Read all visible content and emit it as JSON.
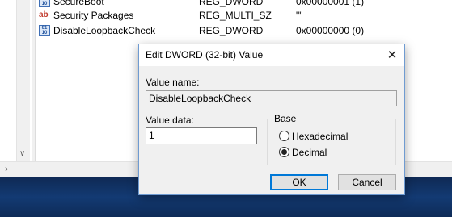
{
  "registry": {
    "rows": [
      {
        "name": "SecureBoot",
        "type": "REG_DWORD",
        "data": "0x00000001 (1)",
        "icon": "dword-icon"
      },
      {
        "name": "Security Packages",
        "type": "REG_MULTI_SZ",
        "data": "\"\"",
        "icon": "string-ab-icon"
      },
      {
        "name": "DisableLoopbackCheck",
        "type": "REG_DWORD",
        "data": "0x00000000 (0)",
        "icon": "dword-icon"
      }
    ]
  },
  "dialog": {
    "title": "Edit DWORD (32-bit) Value",
    "value_name_label": "Value name:",
    "value_name": "DisableLoopbackCheck",
    "value_data_label": "Value data:",
    "value_data": "1",
    "base_label": "Base",
    "base_options": [
      {
        "label": "Hexadecimal",
        "selected": false
      },
      {
        "label": "Decimal",
        "selected": true
      }
    ],
    "ok_label": "OK",
    "cancel_label": "Cancel"
  },
  "colors": {
    "taskbar": "#133a73",
    "dialog_border": "#6f9bd1",
    "default_button": "#0078d7"
  }
}
